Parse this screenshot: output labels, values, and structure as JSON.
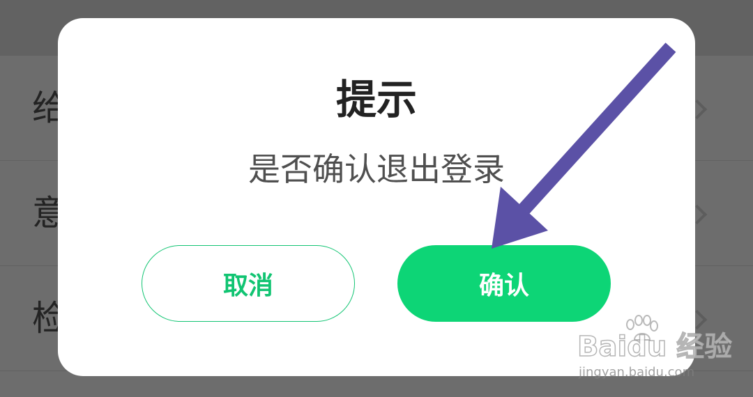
{
  "background": {
    "rows": [
      {
        "label": "给"
      },
      {
        "label": "意"
      },
      {
        "label": "检"
      }
    ]
  },
  "dialog": {
    "title": "提示",
    "message": "是否确认退出登录",
    "cancel_label": "取消",
    "confirm_label": "确认"
  },
  "watermark": {
    "brand": "Baidu 经验",
    "url": "jingyan.baidu.com"
  },
  "colors": {
    "accent": "#0dd576",
    "overlay": "#6b6b6b",
    "arrow": "#5b51a6",
    "dialog_bg": "#ffffff"
  },
  "icons": {
    "arrow": "arrow-annotation-icon",
    "chevron": "chevron-right-icon",
    "paw": "baidu-paw-icon"
  }
}
